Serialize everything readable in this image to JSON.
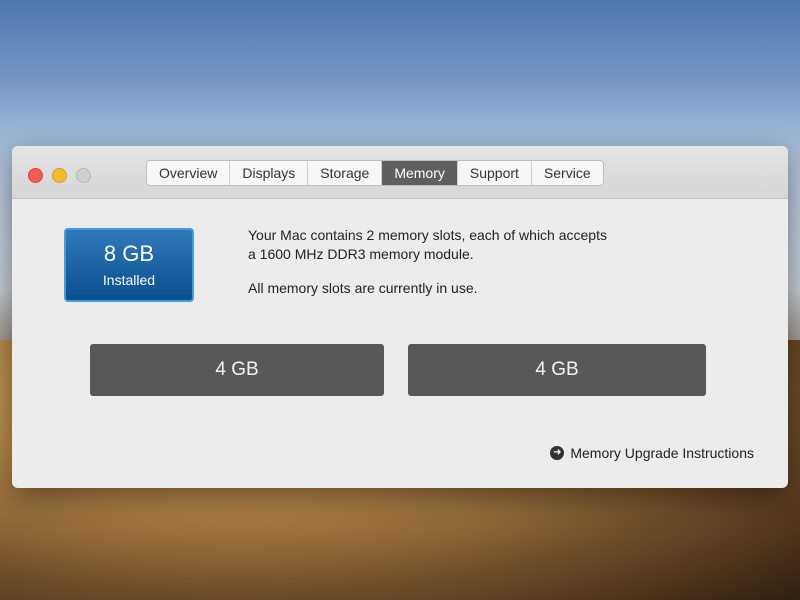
{
  "tabs": [
    {
      "label": "Overview"
    },
    {
      "label": "Displays"
    },
    {
      "label": "Storage"
    },
    {
      "label": "Memory",
      "active": true
    },
    {
      "label": "Support"
    },
    {
      "label": "Service"
    }
  ],
  "summary": {
    "size": "8 GB",
    "status": "Installed"
  },
  "info": {
    "line1": "Your Mac contains 2 memory slots, each of which accepts",
    "line2": "a 1600 MHz DDR3 memory module.",
    "line3": "All memory slots are currently in use."
  },
  "slots": [
    {
      "label": "4 GB"
    },
    {
      "label": "4 GB"
    }
  ],
  "upgrade_link": {
    "label": "Memory Upgrade Instructions",
    "icon": "arrow-circle-right-icon"
  },
  "colors": {
    "accent": "#1f6fb2",
    "slot_bg": "#585858",
    "active_tab": "#5f5f5f"
  }
}
